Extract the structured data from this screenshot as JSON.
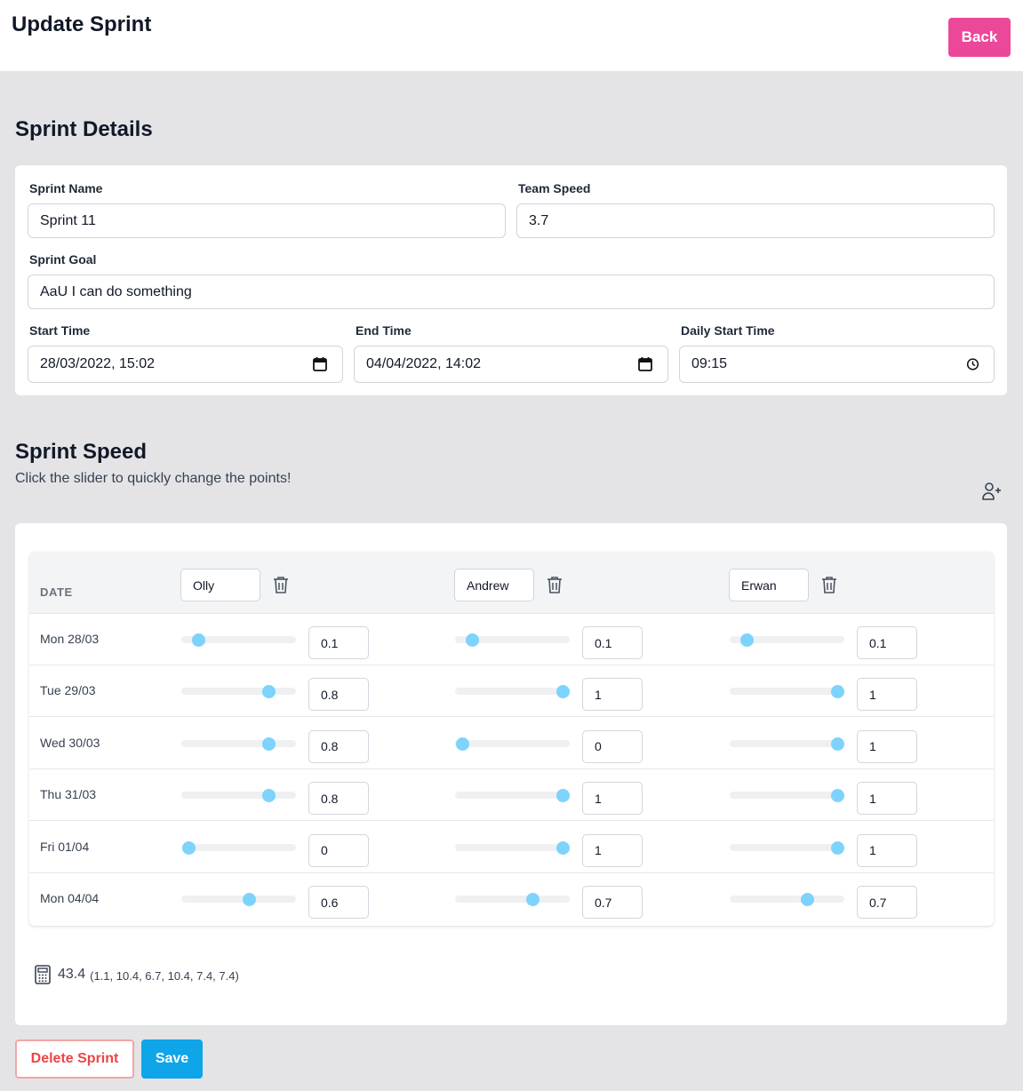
{
  "header": {
    "title": "Update Sprint",
    "back_label": "Back"
  },
  "details": {
    "section_title": "Sprint Details",
    "sprint_name_label": "Sprint Name",
    "sprint_name_value": "Sprint 11",
    "team_speed_label": "Team Speed",
    "team_speed_value": "3.7",
    "sprint_goal_label": "Sprint Goal",
    "sprint_goal_value": "AaU I can do something",
    "start_time_label": "Start Time",
    "start_time_value": "28/03/2022, 15:02",
    "end_time_label": "End Time",
    "end_time_value": "04/04/2022, 14:02",
    "daily_start_label": "Daily Start Time",
    "daily_start_value": "09:15"
  },
  "speed": {
    "section_title": "Sprint Speed",
    "subtitle": "Click the slider to quickly change the points!",
    "date_header": "DATE",
    "members": [
      "Olly",
      "Andrew",
      "Erwan"
    ],
    "rows": [
      {
        "date": "Mon 28/03",
        "values": [
          "0.1",
          "0.1",
          "0.1"
        ]
      },
      {
        "date": "Tue 29/03",
        "values": [
          "0.8",
          "1",
          "1"
        ]
      },
      {
        "date": "Wed 30/03",
        "values": [
          "0.8",
          "0",
          "1"
        ]
      },
      {
        "date": "Thu 31/03",
        "values": [
          "0.8",
          "1",
          "1"
        ]
      },
      {
        "date": "Fri 01/04",
        "values": [
          "0",
          "1",
          "1"
        ]
      },
      {
        "date": "Mon 04/04",
        "values": [
          "0.6",
          "0.7",
          "0.7"
        ]
      }
    ],
    "slider_range": [
      0,
      1
    ],
    "total": "43.4",
    "total_detail": "(1.1, 10.4, 6.7, 10.4, 7.4, 7.4)"
  },
  "actions": {
    "delete_label": "Delete Sprint",
    "save_label": "Save"
  },
  "colors": {
    "accent_pink": "#ec4899",
    "accent_blue": "#0ea5e9",
    "slider_knob": "#7dd3fc",
    "danger": "#ef4444"
  }
}
